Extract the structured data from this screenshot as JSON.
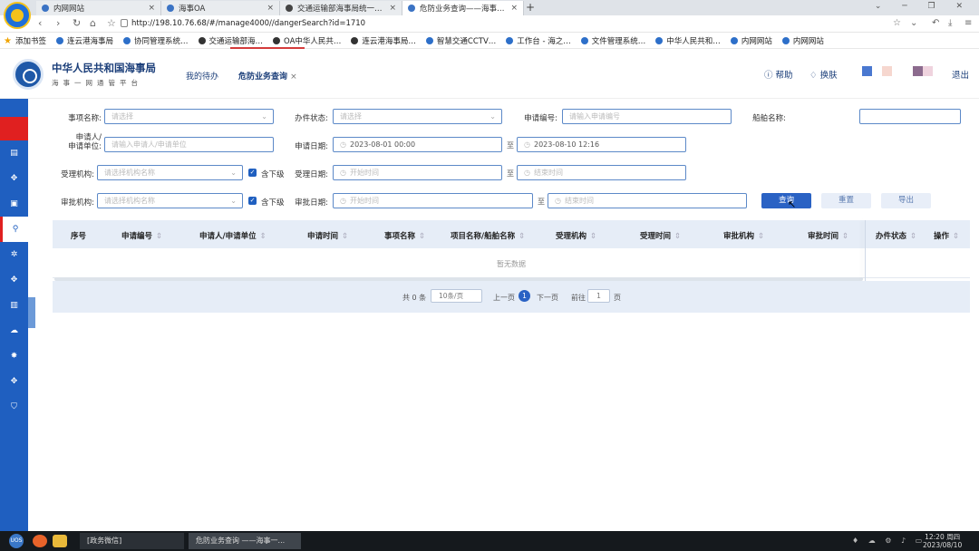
{
  "browser": {
    "tabs": [
      {
        "label": "内网网站",
        "close": "×"
      },
      {
        "label": "海事OA",
        "close": "×"
      },
      {
        "label": "交通运输部海事局统一身份...",
        "close": "×"
      },
      {
        "label": "危防业务查询——海事一网...",
        "close": "×"
      }
    ],
    "new_tab": "+",
    "url": "http://198.10.76.68/#/manage4000//dangerSearch?id=1710",
    "bookmarks": [
      "添加书签",
      "连云港海事局",
      "协同管理系统…",
      "交通运输部海…",
      "OA中华人民共…",
      "连云港海事局…",
      "智慧交通CCTV…",
      "工作台 - 海之…",
      "文件管理系统…",
      "中华人民共和…",
      "内网网站",
      "内网网站"
    ]
  },
  "header": {
    "org_title": "中华人民共和国海事局",
    "org_subtitle": "海事一网通管平台",
    "tabs": [
      {
        "label": "我的待办"
      },
      {
        "label": "危防业务查询",
        "close": "×"
      }
    ],
    "help": "帮助",
    "skin": "换肤",
    "logout": "退出",
    "swatch_colors": [
      "#4a78d0",
      "#f6d7cf",
      "#8c6b8e",
      "#efd3de"
    ]
  },
  "form": {
    "item_name_label": "事项名称:",
    "item_name_placeholder": "请选择",
    "status_label": "办件状态:",
    "status_placeholder": "请选择",
    "apply_no_label": "申请编号:",
    "apply_no_placeholder": "请输入申请编号",
    "ship_name_label": "船舶名称:",
    "applicant_label_1": "申请人/",
    "applicant_label_2": "申请单位:",
    "applicant_placeholder": "请输入申请人/申请单位",
    "apply_date_label": "申请日期:",
    "apply_date_start": "2023-08-01 00:00",
    "apply_date_end": "2023-08-10 12:16",
    "accept_org_label": "受理机构:",
    "accept_org_placeholder": "请选择机构名称",
    "include_sub_label": "含下级",
    "accept_date_label": "受理日期:",
    "start_placeholder": "开始时间",
    "end_placeholder": "结束时间",
    "approve_org_label": "审批机构:",
    "approve_org_placeholder": "请选择机构名称",
    "approve_date_label": "审批日期:",
    "approve_start_placeholder": "开始时间",
    "approve_end_placeholder": "结束时间",
    "to": "至",
    "search_btn": "查询",
    "reset_btn": "重置",
    "export_btn": "导出"
  },
  "table": {
    "columns": [
      "序号",
      "申请编号",
      "申请人/申请单位",
      "申请时间",
      "事项名称",
      "项目名称/船舶名称",
      "受理机构",
      "受理时间",
      "审批机构",
      "审批时间",
      "办件状态",
      "操作"
    ],
    "empty_text": "暂无数据"
  },
  "pagination": {
    "total": "共 0 条",
    "page_size": "10条/页",
    "prev": "上一页",
    "current": "1",
    "next": "下一页",
    "goto": "前往",
    "goto_value": "1",
    "page_unit": "页"
  },
  "taskbar": {
    "windows": [
      "[政务微信]",
      "危防业务查询 ——海事一..."
    ],
    "start_label": "UOS",
    "time": "12:20 周四",
    "date": "2023/08/10"
  }
}
